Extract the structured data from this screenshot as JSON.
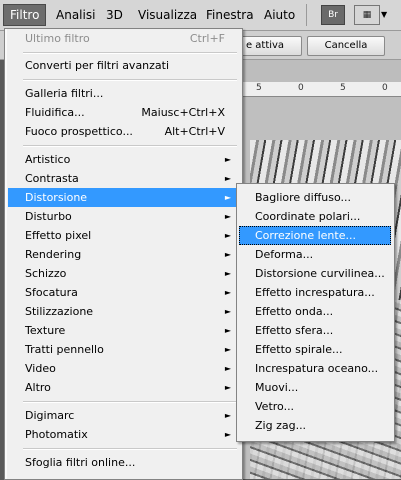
{
  "menubar": {
    "items": [
      "Filtro",
      "Analisi",
      "3D",
      "Visualizza",
      "Finestra",
      "Aiuto"
    ],
    "bridge_label": "Br"
  },
  "options_bar": {
    "apply_label": "e attiva",
    "cancel_label": "Cancella"
  },
  "ruler": {
    "ticks": [
      "5",
      "0",
      "5",
      "0"
    ]
  },
  "filter_menu": {
    "last_filter": {
      "label": "Ultimo filtro",
      "shortcut": "Ctrl+F"
    },
    "convert_smart": "Converti per filtri avanzati",
    "gallery": "Galleria filtri...",
    "liquify": {
      "label": "Fluidifica...",
      "shortcut": "Maiusc+Ctrl+X"
    },
    "vanishing_point": {
      "label": "Fuoco prospettico...",
      "shortcut": "Alt+Ctrl+V"
    },
    "groups": [
      "Artistico",
      "Contrasta",
      "Distorsione",
      "Disturbo",
      "Effetto pixel",
      "Rendering",
      "Schizzo",
      "Sfocatura",
      "Stilizzazione",
      "Texture",
      "Tratti pennello",
      "Video",
      "Altro"
    ],
    "plugins": [
      "Digimarc",
      "Photomatix"
    ],
    "browse_online": "Sfoglia filtri online..."
  },
  "distort_submenu": {
    "items": [
      "Bagliore diffuso...",
      "Coordinate polari...",
      "Correzione lente...",
      "Deforma...",
      "Distorsione curvilinea...",
      "Effetto increspatura...",
      "Effetto onda...",
      "Effetto sfera...",
      "Effetto spirale...",
      "Increspatura oceano...",
      "Muovi...",
      "Vetro...",
      "Zig zag..."
    ]
  },
  "colors": {
    "highlight": "#3399ff",
    "menubar_active": "#6d6d6d"
  }
}
